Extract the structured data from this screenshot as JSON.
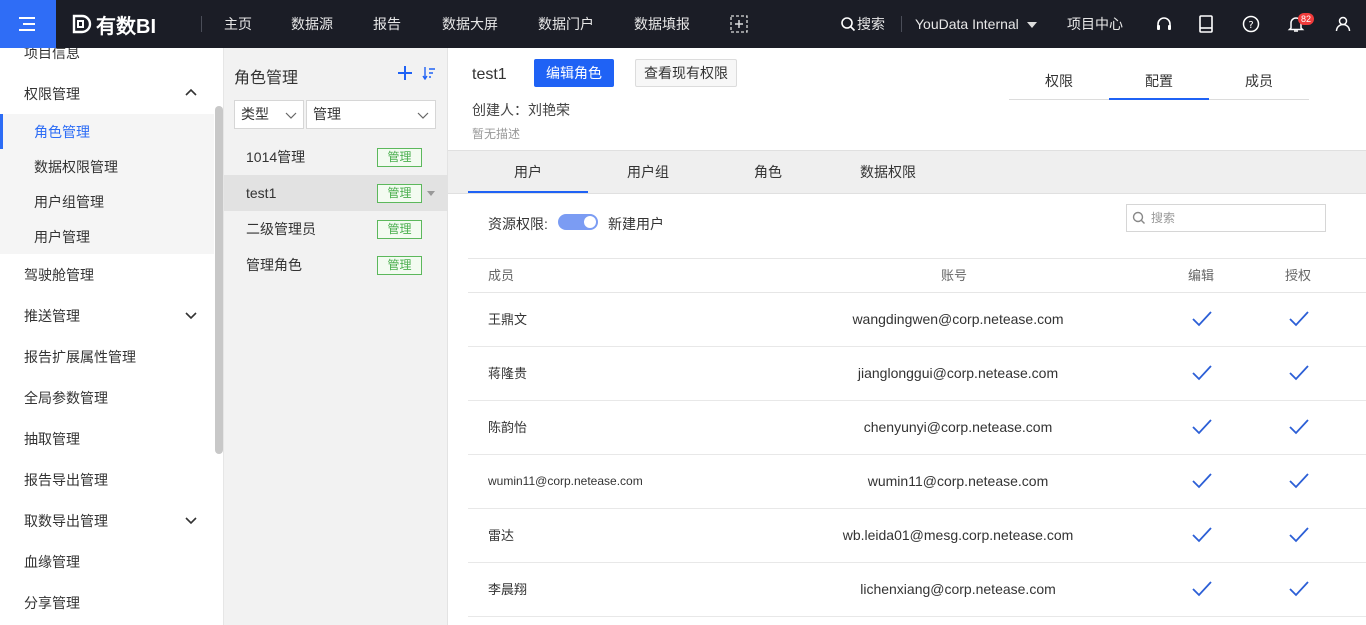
{
  "topbar": {
    "logo_text": "有数BI",
    "nav": [
      "主页",
      "数据源",
      "报告",
      "数据大屏",
      "数据门户",
      "数据填报"
    ],
    "search_label": "搜索",
    "workspace": "YouData Internal",
    "project_center": "项目中心",
    "notification_count": "82"
  },
  "sidebar": {
    "items": [
      {
        "label": "项目信息"
      },
      {
        "label": "权限管理"
      },
      {
        "label": "角色管理"
      },
      {
        "label": "数据权限管理"
      },
      {
        "label": "用户组管理"
      },
      {
        "label": "用户管理"
      },
      {
        "label": "驾驶舱管理"
      },
      {
        "label": "推送管理"
      },
      {
        "label": "报告扩展属性管理"
      },
      {
        "label": "全局参数管理"
      },
      {
        "label": "抽取管理"
      },
      {
        "label": "报告导出管理"
      },
      {
        "label": "取数导出管理"
      },
      {
        "label": "血缘管理"
      },
      {
        "label": "分享管理"
      }
    ]
  },
  "role_panel": {
    "title": "角色管理",
    "filter_type": "类型",
    "filter_value": "管理",
    "roles": [
      {
        "name": "1014管理",
        "tag": "管理"
      },
      {
        "name": "test1",
        "tag": "管理"
      },
      {
        "name": "二级管理员",
        "tag": "管理"
      },
      {
        "name": "管理角色",
        "tag": "管理"
      }
    ]
  },
  "main": {
    "role_name": "test1",
    "edit_button": "编辑角色",
    "view_perm_button": "查看现有权限",
    "creator": "创建人：刘艳荣",
    "description": "暂无描述",
    "right_tabs": [
      "权限",
      "配置",
      "成员"
    ],
    "sub_tabs": [
      "用户",
      "用户组",
      "角色",
      "数据权限"
    ],
    "resource_perm_label": "资源权限:",
    "new_user_label": "新建用户",
    "search_placeholder": "搜索",
    "table": {
      "headers": [
        "成员",
        "账号",
        "编辑",
        "授权"
      ],
      "rows": [
        {
          "member": "王鼎文",
          "account": "wangdingwen@corp.netease.com"
        },
        {
          "member": "蒋隆贵",
          "account": "jianglonggui@corp.netease.com"
        },
        {
          "member": "陈韵怡",
          "account": "chenyunyi@corp.netease.com"
        },
        {
          "member": "wumin11@corp.netease.com",
          "account": "wumin11@corp.netease.com"
        },
        {
          "member": "雷达",
          "account": "wb.leida01@mesg.corp.netease.com"
        },
        {
          "member": "李晨翔",
          "account": "lichenxiang@corp.netease.com"
        }
      ]
    }
  }
}
